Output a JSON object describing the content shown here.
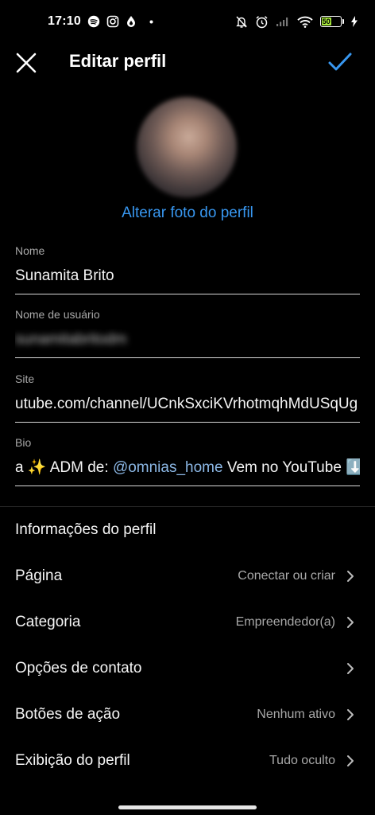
{
  "status": {
    "time": "17:10",
    "battery": "50",
    "left_icons": [
      "spotify-icon",
      "instagram-icon",
      "drop-icon",
      "dot-icon"
    ],
    "right_icons": [
      "muted-bell-icon",
      "alarm-icon",
      "signal-icon",
      "wifi-icon",
      "battery-icon",
      "charging-icon"
    ]
  },
  "header": {
    "title": "Editar perfil",
    "close_icon": "close-icon",
    "confirm_icon": "check-icon",
    "accent": "#3897f0"
  },
  "profile": {
    "change_photo": "Alterar foto do perfil"
  },
  "fields": {
    "name": {
      "label": "Nome",
      "value": "Sunamita Brito"
    },
    "username": {
      "label": "Nome de usuário",
      "value": "sunamitabritodm"
    },
    "site": {
      "label": "Site",
      "value": "utube.com/channel/UCnkSxciKVrhotmqhMdUSqUg"
    },
    "bio": {
      "label": "Bio",
      "prefix": "a ✨ ADM de: ",
      "mention": "@omnias_home",
      "suffix": " Vem no YouTube ⬇️"
    }
  },
  "section": {
    "title": "Informações do perfil"
  },
  "rows": [
    {
      "label": "Página",
      "value": "Conectar ou criar"
    },
    {
      "label": "Categoria",
      "value": "Empreendedor(a)"
    },
    {
      "label": "Opções de contato",
      "value": ""
    },
    {
      "label": "Botões de ação",
      "value": "Nenhum ativo"
    },
    {
      "label": "Exibição do perfil",
      "value": "Tudo oculto"
    }
  ]
}
